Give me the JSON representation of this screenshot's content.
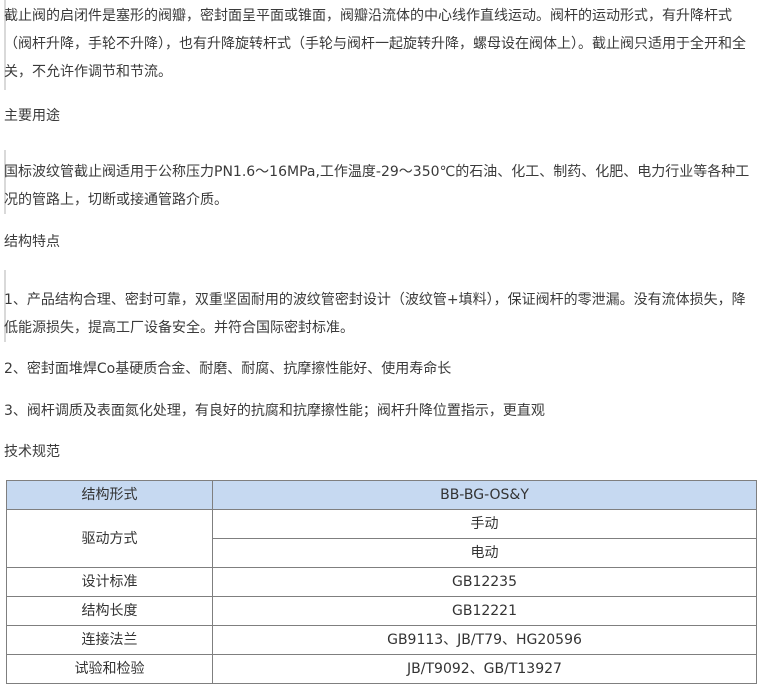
{
  "intro_paragraph": "截止阀的启闭件是塞形的阀瓣，密封面呈平面或锥面，阀瓣沿流体的中心线作直线运动。阀杆的运动形式，有升降杆式（阀杆升降，手轮不升降），也有升降旋转杆式（手轮与阀杆一起旋转升降，螺母设在阀体上）。截止阀只适用于全开和全关，不允许作调节和节流。",
  "section_usage": {
    "title": "主要用途",
    "text": "国标波纹管截止阀适用于公称压力PN1.6～16MPa,工作温度-29～350℃的石油、化工、制药、化肥、电力行业等各种工况的管路上，切断或接通管路介质。"
  },
  "section_features": {
    "title": "结构特点",
    "items": [
      "1、产品结构合理、密封可靠，双重坚固耐用的波纹管密封设计（波纹管+填料），保证阀杆的零泄漏。没有流体损失，降低能源损失，提高工厂设备安全。并符合国际密封标准。",
      "2、密封面堆焊Co基硬质合金、耐磨、耐腐、抗摩擦性能好、使用寿命长",
      "3、阀杆调质及表面氮化处理，有良好的抗腐和抗摩擦性能；阀杆升降位置指示，更直观"
    ]
  },
  "section_specs": {
    "title": "技术规范",
    "table": {
      "header": {
        "label": "结构形式",
        "value": "BB-BG-OS&Y"
      },
      "drive": {
        "label": "驱动方式",
        "values": [
          "手动",
          "电动"
        ]
      },
      "rows": [
        {
          "label": "设计标准",
          "value": "GB12235"
        },
        {
          "label": "结构长度",
          "value": "GB12221"
        },
        {
          "label": "连接法兰",
          "value": "GB9113、JB/T79、HG20596"
        },
        {
          "label": "试验和检验",
          "value": "JB/T9092、GB/T13927"
        }
      ]
    }
  },
  "colors": {
    "table_header_bg": "#c6d9f1",
    "text": "#3a3a3a",
    "border": "#7f7f7f"
  }
}
